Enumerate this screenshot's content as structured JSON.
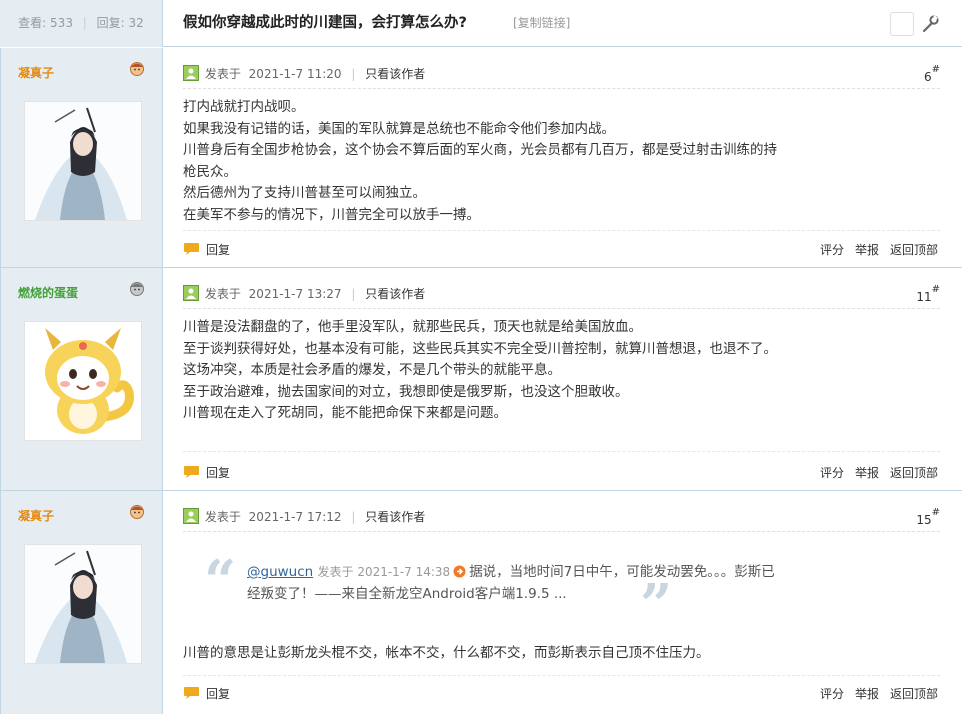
{
  "thread": {
    "views_label": "查看:",
    "views": "533",
    "replies_label": "回复:",
    "replies": "32",
    "title": "假如你穿越成此时的川建国，会打算怎么办?",
    "copy_link": "[复制链接]"
  },
  "labels": {
    "posted_prefix": "发表于",
    "only_author": "只看该作者",
    "reply": "回复",
    "rate": "评分",
    "report": "举报",
    "back_top": "返回顶部"
  },
  "colors": {
    "username_orange": "#e58b12",
    "username_green": "#44a03a",
    "sidebar_bg": "#e5edf2",
    "border": "#c2d5e3"
  },
  "posts": [
    {
      "username": "凝真子",
      "group_icon": "user-face-icon",
      "date": "2021-1-7 11:20",
      "floor": "6",
      "lines": [
        "打内战就打内战呗。",
        "如果我没有记错的话，美国的军队就算是总统也不能命令他们参加内战。",
        "川普身后有全国步枪协会，这个协会不算后面的军火商，光会员都有几百万，都是受过射击训练的持",
        "枪民众。",
        "然后德州为了支持川普甚至可以闹独立。",
        "在美军不参与的情况下，川普完全可以放手一搏。"
      ]
    },
    {
      "username": "燃烧的蛋蛋",
      "group_icon": "gray-user-icon",
      "date": "2021-1-7 13:27",
      "floor": "11",
      "lines": [
        "川普是没法翻盘的了，他手里没军队，就那些民兵，顶天也就是给美国放血。",
        "至于谈判获得好处，也基本没有可能，这些民兵其实不完全受川普控制，就算川普想退，也退不了。",
        "这场冲突，本质是社会矛盾的爆发，不是几个带头的就能平息。",
        "至于政治避难，抛去国家间的对立，我想即使是俄罗斯，也没这个胆敢收。",
        "川普现在走入了死胡同，能不能把命保下来都是问题。"
      ]
    },
    {
      "username": "凝真子",
      "group_icon": "user-face-icon",
      "date": "2021-1-7 17:12",
      "floor": "15",
      "quote": {
        "user": "@guwucn",
        "meta": "发表于 2021-1-7 14:38",
        "line1": "据说，当地时间7日中午，可能发动罢免。。。彭斯已",
        "line2": "经叛变了！——来自全新龙空Android客户端1.9.5 ..."
      },
      "lines": [
        "川普的意思是让彭斯龙头棍不交，帐本不交，什么都不交，而彭斯表示自己顶不住压力。"
      ]
    }
  ]
}
